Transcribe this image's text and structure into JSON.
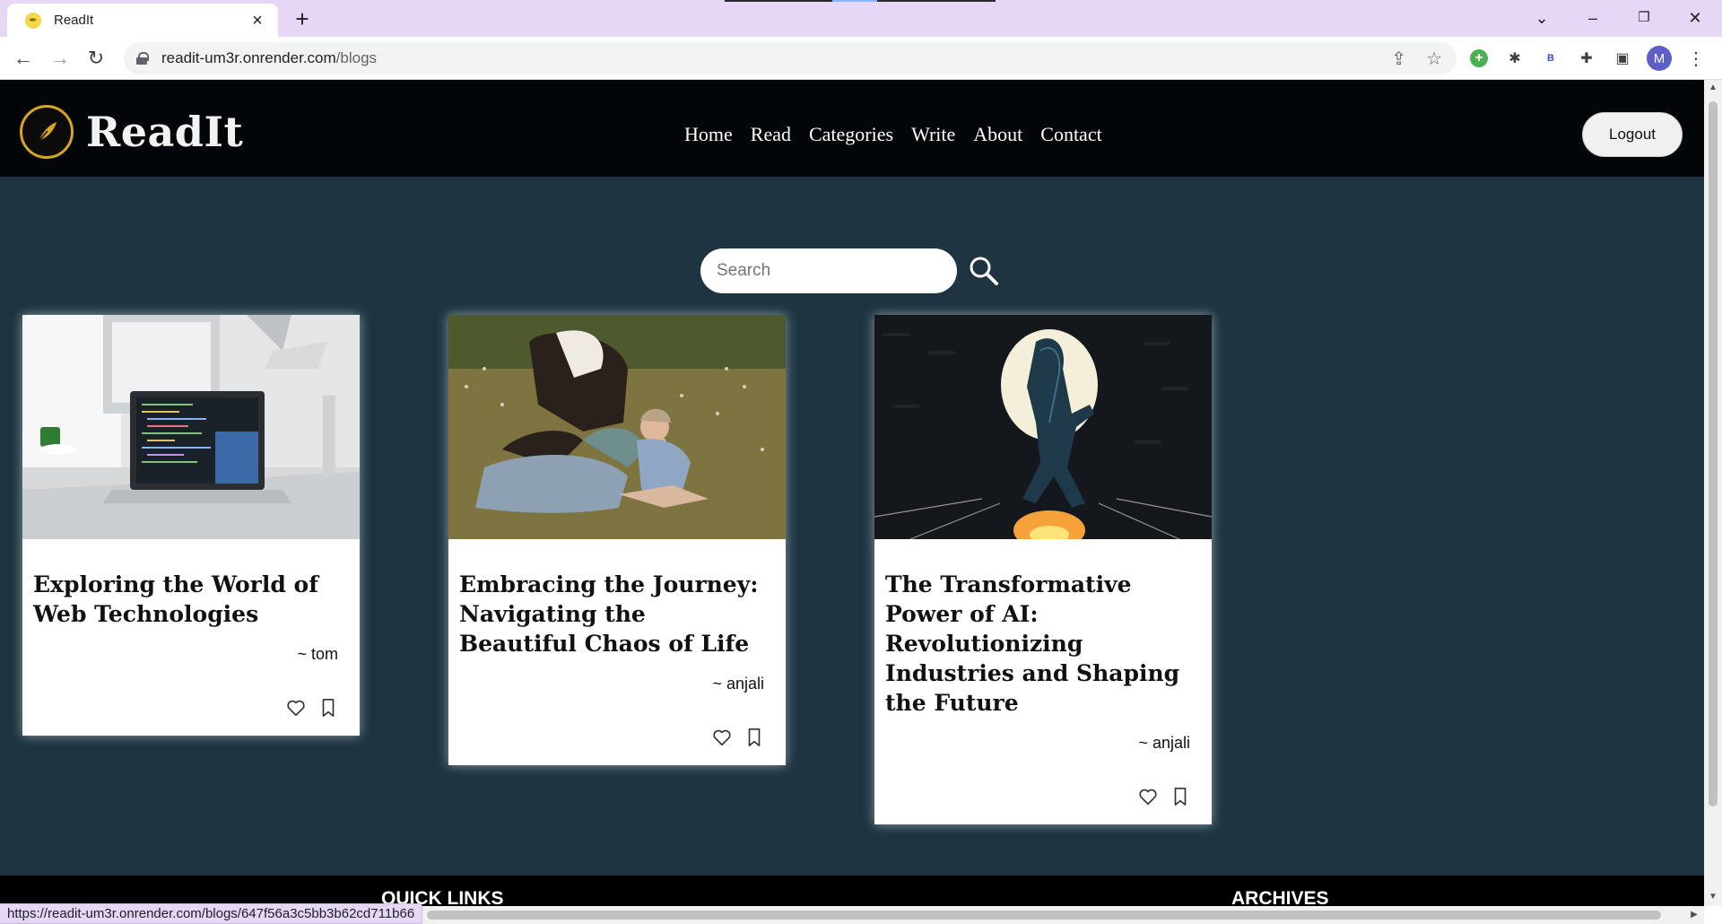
{
  "browser": {
    "tab_title": "ReadIt",
    "url_host": "readit-um3r.onrender.com",
    "url_path": "/blogs",
    "profile_initial": "M",
    "extension_letter": "B",
    "status_url": "https://readit-um3r.onrender.com/blogs/647f56a3c5bb3b62cd711b66"
  },
  "site": {
    "logo_text": "ReadIt",
    "nav": [
      "Home",
      "Read",
      "Categories",
      "Write",
      "About",
      "Contact"
    ],
    "logout_label": "Logout",
    "search_placeholder": "Search"
  },
  "posts": [
    {
      "title": "Exploring the World of Web Technologies",
      "author": "~ tom",
      "image": "laptop-on-desk"
    },
    {
      "title": "Embracing the Journey: Navigating the Beautiful Chaos of Life",
      "author": "~ anjali",
      "image": "person-with-cow-in-field"
    },
    {
      "title": "The Transformative Power of AI: Revolutionizing Industries and Shaping the Future",
      "author": "~ anjali",
      "image": "robot-kneeling-before-moon"
    }
  ],
  "footer": {
    "quick_links_heading": "QUICK LINKS",
    "archives_heading": "ARCHIVES"
  },
  "colors": {
    "page_bg": "#1e3440",
    "header_bg": "#030608",
    "logo_accent": "#d9a520",
    "tabbar_bg": "#e6d7f6"
  }
}
